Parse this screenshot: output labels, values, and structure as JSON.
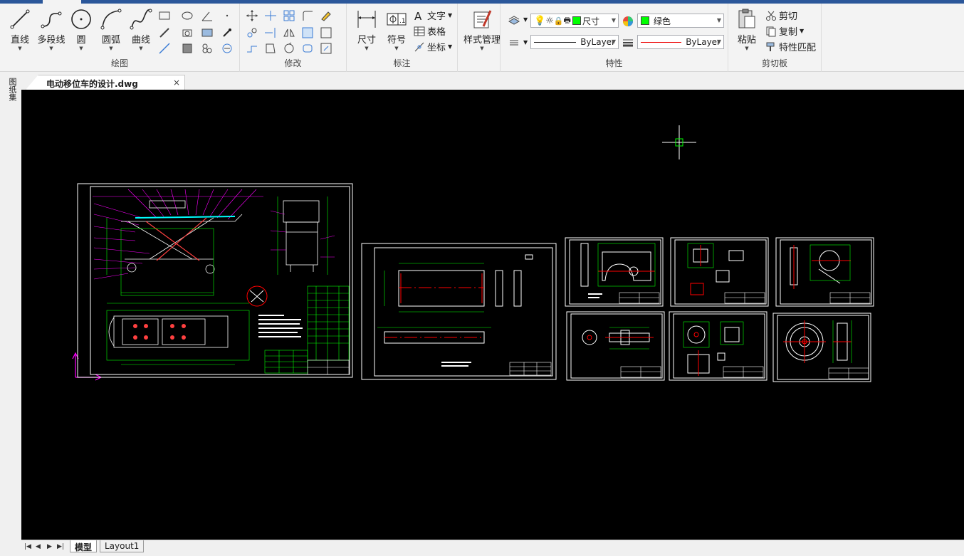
{
  "ribbon": {
    "draw": {
      "label": "绘图",
      "line": "直线",
      "polyline": "多段线",
      "circle": "圆",
      "arc": "圆弧",
      "curve": "曲线"
    },
    "modify": {
      "label": "修改"
    },
    "annotate": {
      "label": "标注",
      "dimension": "尺寸",
      "symbol": "符号",
      "text": "文字",
      "table": "表格",
      "coordinate": "坐标",
      "style_manager": "样式管理"
    },
    "properties": {
      "label": "特性",
      "layer_value": "尺寸",
      "color_value": "绿色",
      "linetype_value": "ByLayer",
      "lineweight_value": "ByLayer"
    },
    "clipboard": {
      "label": "剪切板",
      "paste": "粘贴",
      "cut": "剪切",
      "copy": "复制",
      "match_props": "特性匹配"
    }
  },
  "document": {
    "tab_title": "电动移位车的设计.dwg",
    "close_glyph": "×"
  },
  "left_strip": {
    "label": "图纸集"
  },
  "layout_tabs": [
    {
      "label": "模型",
      "active": true
    },
    {
      "label": "Layout1",
      "active": false
    }
  ],
  "colors": {
    "ribbon_bg": "#f3f3f3",
    "title_blue": "#2b579a",
    "canvas_bg": "#000000",
    "drawing_white": "#ffffff",
    "drawing_magenta": "#ff00ff",
    "drawing_green": "#00ff00",
    "drawing_red": "#ff0000",
    "layer_green": "#00ff00"
  }
}
